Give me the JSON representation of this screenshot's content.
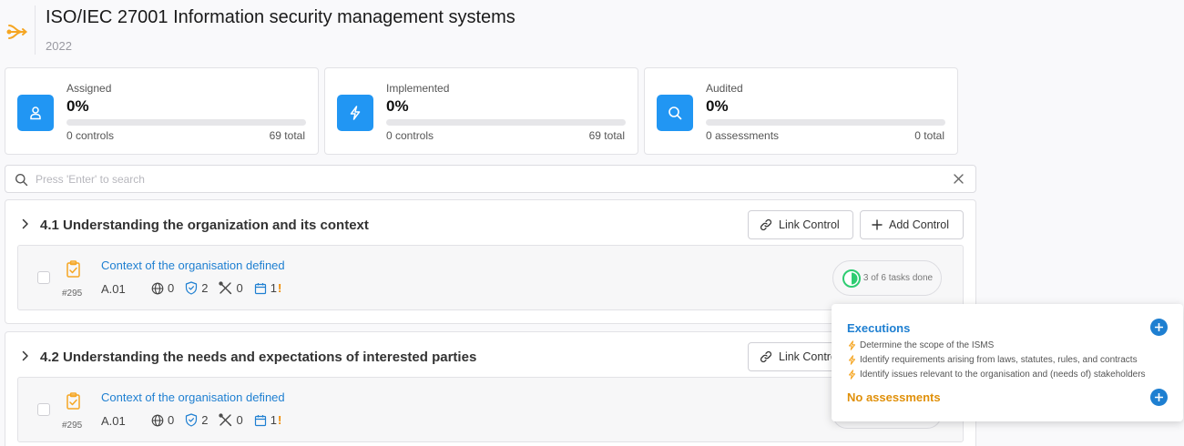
{
  "header": {
    "title": "ISO/IEC 27001 Information security management systems",
    "year": "2022",
    "logo_icon": "network-flow-icon",
    "accent_color": "#f5a623"
  },
  "stats": [
    {
      "label": "Assigned",
      "value": "0%",
      "progress_percent": 0,
      "count": "0 controls",
      "total": "69 total",
      "icon": "user-icon"
    },
    {
      "label": "Implemented",
      "value": "0%",
      "progress_percent": 0,
      "count": "0 controls",
      "total": "69 total",
      "icon": "bolt-icon"
    },
    {
      "label": "Audited",
      "value": "0%",
      "progress_percent": 0,
      "count": "0 assessments",
      "total": "0 total",
      "icon": "search-icon"
    }
  ],
  "search": {
    "placeholder": "Press 'Enter' to search",
    "value": ""
  },
  "buttons": {
    "link_control": "Link Control",
    "add_control": "Add Control"
  },
  "sections": [
    {
      "title": "4.1 Understanding the organization and its context",
      "control": {
        "title": "Context of the organisation defined",
        "id": "#295",
        "code": "A.01",
        "globe_count": "0",
        "shield_count": "2",
        "tools_count": "0",
        "calendar_count": "1",
        "alert": "!",
        "tasks_text": "3 of 6 tasks done",
        "tasks_done": 3,
        "tasks_total": 6
      }
    },
    {
      "title": "4.2 Understanding the needs and expectations of interested parties",
      "control": {
        "title": "Context of the organisation defined",
        "id": "#295",
        "code": "A.01",
        "globe_count": "0",
        "shield_count": "2",
        "tools_count": "0",
        "calendar_count": "1",
        "alert": "!"
      }
    }
  ],
  "popover": {
    "executions_title": "Executions",
    "executions": [
      "Determine the scope of the ISMS",
      "Identify requirements arising from laws, statutes, rules, and contracts",
      "Identify issues relevant to the organisation and (needs of) stakeholders"
    ],
    "assessments_title": "No assessments"
  },
  "colors": {
    "primary": "#2196f3",
    "link": "#1e7fd1",
    "warning": "#f08a00",
    "success": "#2ecc71"
  }
}
